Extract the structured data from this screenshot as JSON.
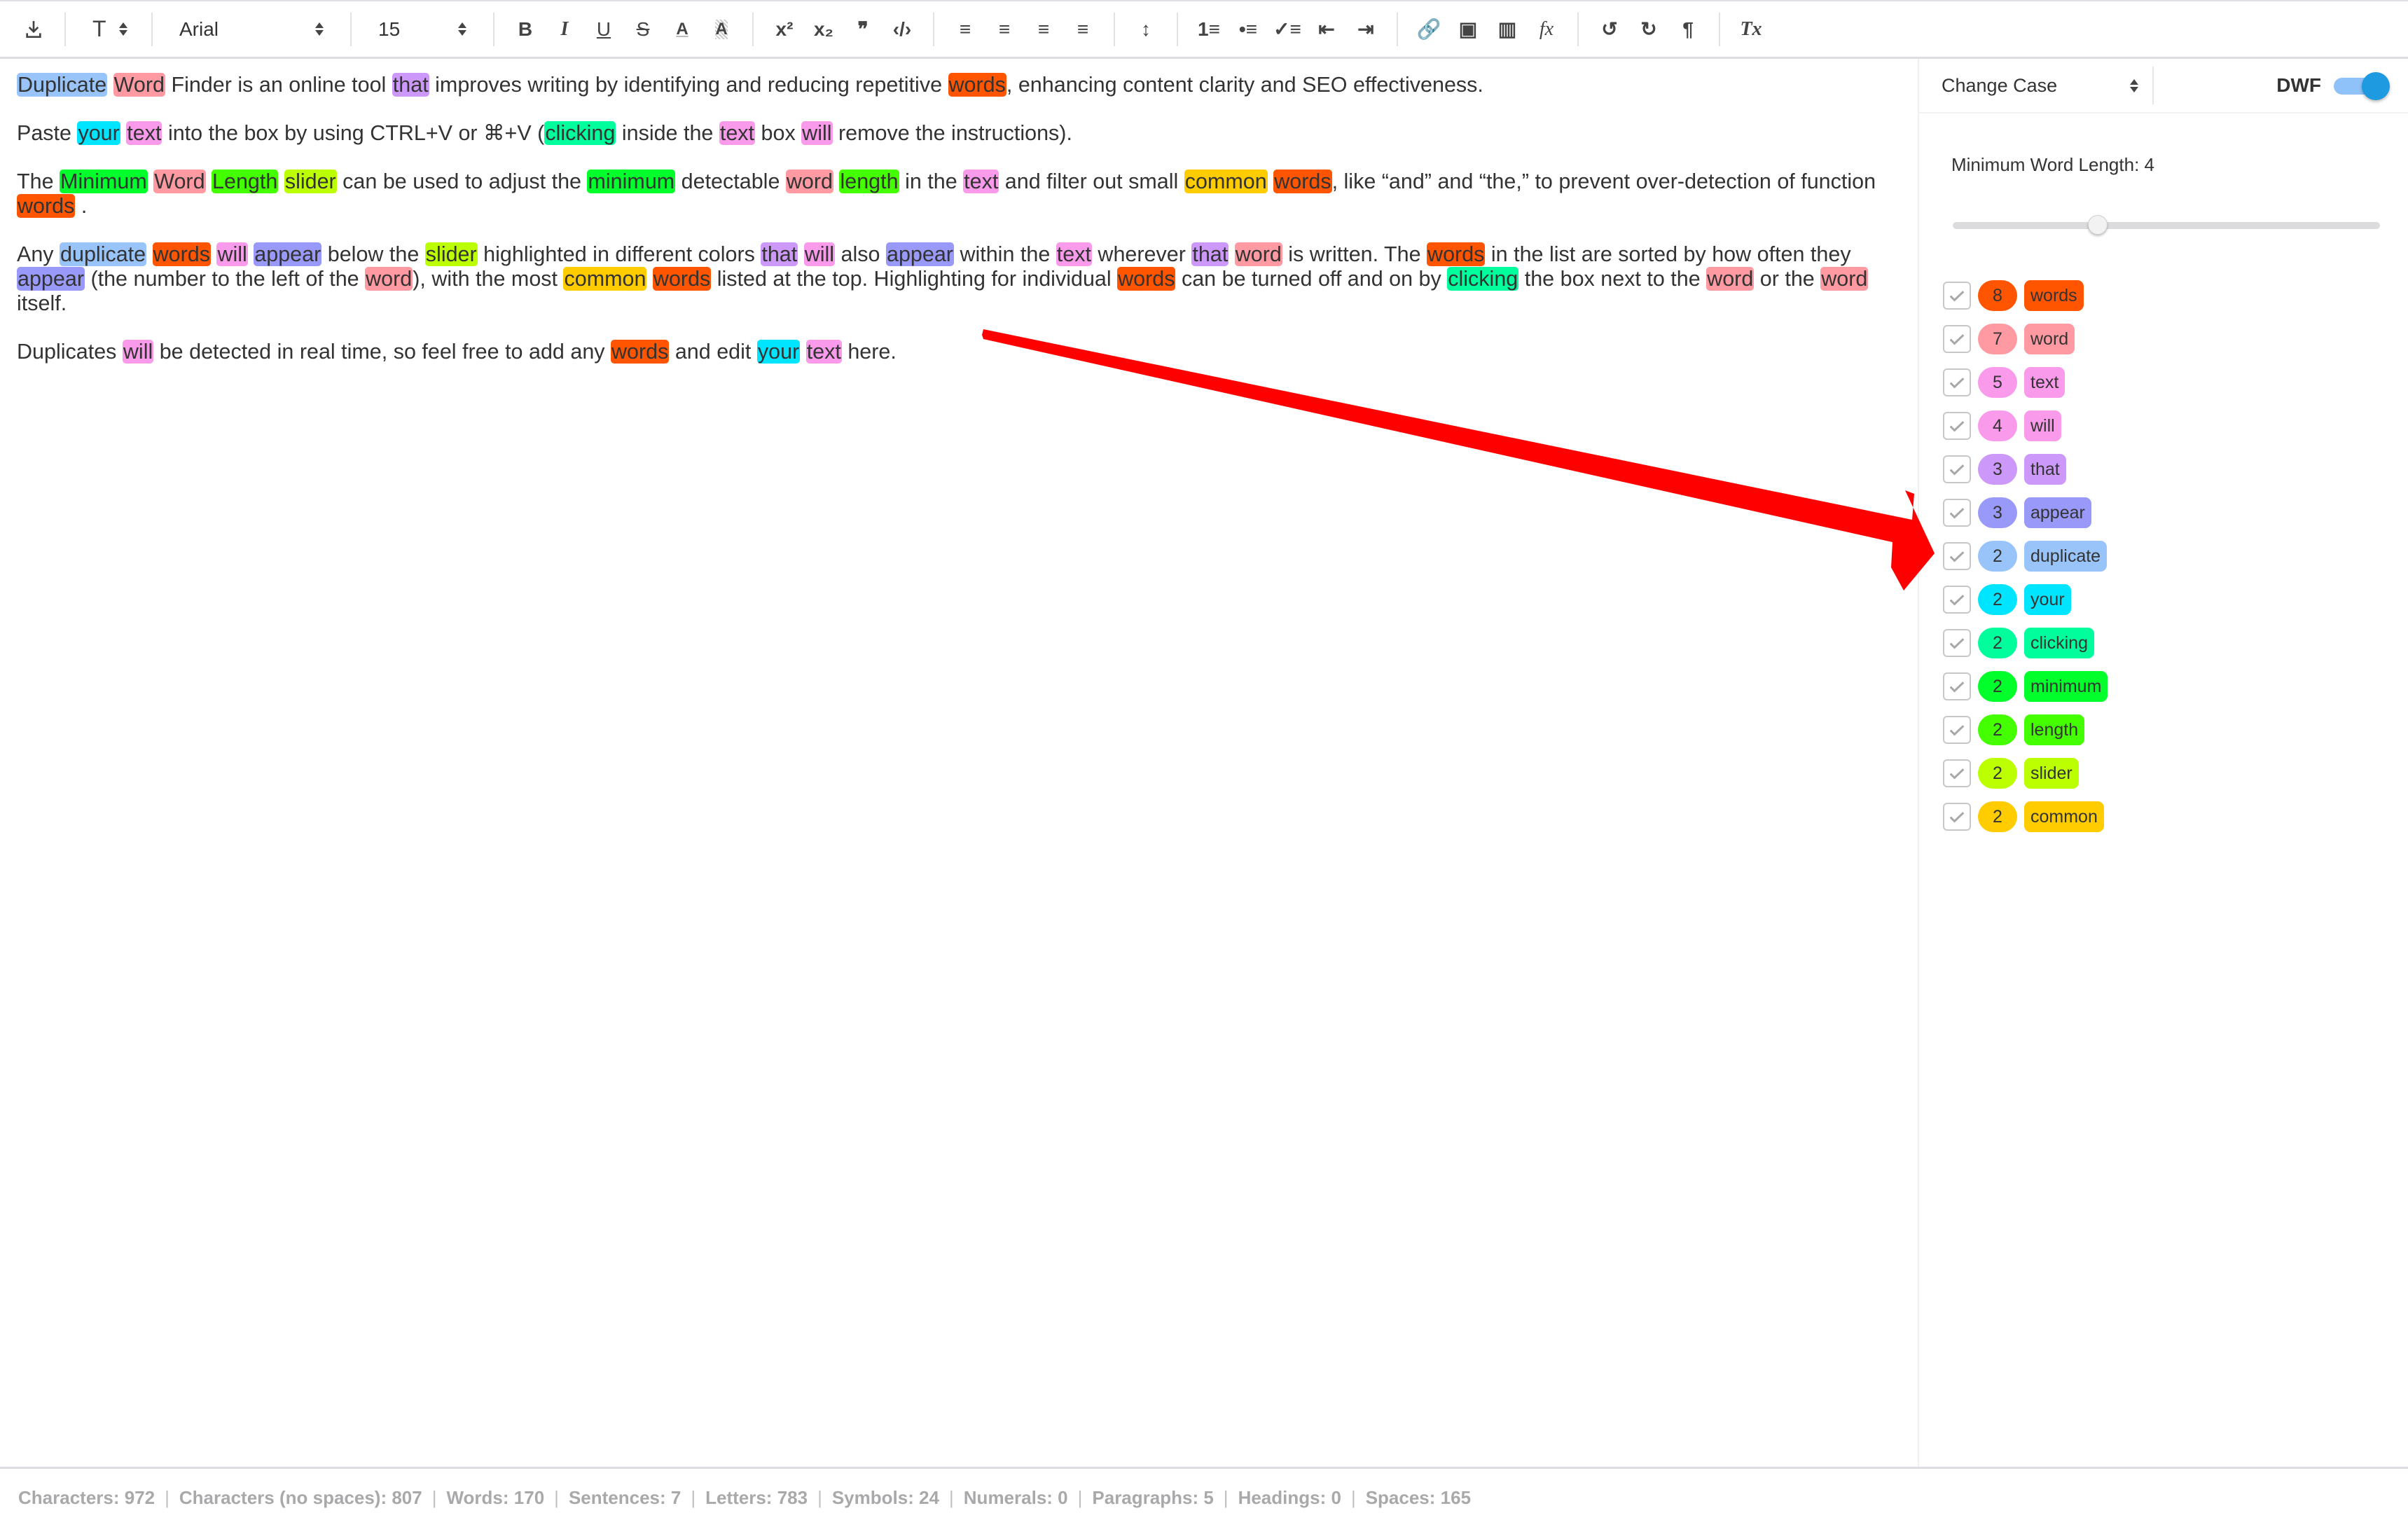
{
  "toolbar": {
    "download_icon": "download-icon",
    "text_style_label": "T",
    "font_family": "Arial",
    "font_size": "15",
    "buttons": [
      {
        "name": "bold",
        "glyph": "B"
      },
      {
        "name": "italic",
        "glyph": "I"
      },
      {
        "name": "underline",
        "glyph": "U"
      },
      {
        "name": "strikethrough",
        "glyph": "S"
      },
      {
        "name": "font-color",
        "glyph": "A"
      },
      {
        "name": "background-color",
        "glyph": "A"
      },
      {
        "name": "superscript",
        "glyph": "x²"
      },
      {
        "name": "subscript",
        "glyph": "x₂"
      },
      {
        "name": "blockquote",
        "glyph": "❞"
      },
      {
        "name": "code",
        "glyph": "‹/›"
      },
      {
        "name": "align-left",
        "glyph": "≡"
      },
      {
        "name": "align-center",
        "glyph": "≡"
      },
      {
        "name": "align-right",
        "glyph": "≡"
      },
      {
        "name": "align-justify",
        "glyph": "≡"
      },
      {
        "name": "line-height",
        "glyph": "↕"
      },
      {
        "name": "ordered-list",
        "glyph": "1≡"
      },
      {
        "name": "bullet-list",
        "glyph": "•≡"
      },
      {
        "name": "check-list",
        "glyph": "✓≡"
      },
      {
        "name": "outdent",
        "glyph": "⇤"
      },
      {
        "name": "indent",
        "glyph": "⇥"
      },
      {
        "name": "link",
        "glyph": "🔗"
      },
      {
        "name": "image",
        "glyph": "▣"
      },
      {
        "name": "video",
        "glyph": "▥"
      },
      {
        "name": "formula",
        "glyph": "fx"
      },
      {
        "name": "undo",
        "glyph": "↺"
      },
      {
        "name": "redo",
        "glyph": "↻"
      },
      {
        "name": "text-direction",
        "glyph": "¶"
      },
      {
        "name": "clear-formatting",
        "glyph": "Tx"
      }
    ]
  },
  "colors": {
    "words": "#ff5500",
    "word": "#ff9aa2",
    "text": "#fa9aeb",
    "will": "#fa9aeb",
    "that": "#cc99fa",
    "appear": "#9999fa",
    "duplicate": "#99c4fa",
    "your": "#00e5ff",
    "clicking": "#00ff9c",
    "minimum": "#00ff2b",
    "length": "#44ff00",
    "slider": "#bbff00",
    "common": "#ffcc00",
    "arrow": "#ff0000",
    "toggle_track": "#90c2fa",
    "toggle_knob": "#1e9be0"
  },
  "editor": {
    "paragraphs": [
      [
        {
          "t": "Duplicate",
          "hl": "duplicate"
        },
        {
          "t": " "
        },
        {
          "t": "Word",
          "hl": "word"
        },
        {
          "t": " Finder is an online tool "
        },
        {
          "t": "that",
          "hl": "that"
        },
        {
          "t": " improves writing by identifying and reducing repetitive "
        },
        {
          "t": "words",
          "hl": "words"
        },
        {
          "t": ", enhancing content clarity and SEO effectiveness."
        }
      ],
      [
        {
          "t": "Paste "
        },
        {
          "t": "your",
          "hl": "your"
        },
        {
          "t": " "
        },
        {
          "t": "text",
          "hl": "text"
        },
        {
          "t": " into the box by using CTRL+V or ⌘+V ("
        },
        {
          "t": "clicking",
          "hl": "clicking"
        },
        {
          "t": " inside the "
        },
        {
          "t": "text",
          "hl": "text"
        },
        {
          "t": " box "
        },
        {
          "t": "will",
          "hl": "will"
        },
        {
          "t": " remove the instructions)."
        }
      ],
      [
        {
          "t": "The "
        },
        {
          "t": "Minimum",
          "hl": "minimum"
        },
        {
          "t": " "
        },
        {
          "t": "Word",
          "hl": "word"
        },
        {
          "t": " "
        },
        {
          "t": "Length",
          "hl": "length"
        },
        {
          "t": " "
        },
        {
          "t": "slider",
          "hl": "slider"
        },
        {
          "t": " can be used to adjust the "
        },
        {
          "t": "minimum",
          "hl": "minimum"
        },
        {
          "t": " detectable "
        },
        {
          "t": "word",
          "hl": "word"
        },
        {
          "t": " "
        },
        {
          "t": "length",
          "hl": "length"
        },
        {
          "t": " in the "
        },
        {
          "t": "text",
          "hl": "text"
        },
        {
          "t": " and filter out small "
        },
        {
          "t": "common",
          "hl": "common"
        },
        {
          "t": " "
        },
        {
          "t": "words",
          "hl": "words"
        },
        {
          "t": ", like “and” and “the,” to prevent over-detection of function "
        },
        {
          "t": "words",
          "hl": "words"
        },
        {
          "t": " ."
        }
      ],
      [
        {
          "t": "Any "
        },
        {
          "t": "duplicate",
          "hl": "duplicate"
        },
        {
          "t": " "
        },
        {
          "t": "words",
          "hl": "words"
        },
        {
          "t": " "
        },
        {
          "t": "will",
          "hl": "will"
        },
        {
          "t": " "
        },
        {
          "t": "appear",
          "hl": "appear"
        },
        {
          "t": " below the "
        },
        {
          "t": "slider",
          "hl": "slider"
        },
        {
          "t": " highlighted in different colors "
        },
        {
          "t": "that",
          "hl": "that"
        },
        {
          "t": " "
        },
        {
          "t": "will",
          "hl": "will"
        },
        {
          "t": " also "
        },
        {
          "t": "appear",
          "hl": "appear"
        },
        {
          "t": " within the "
        },
        {
          "t": "text",
          "hl": "text"
        },
        {
          "t": " wherever "
        },
        {
          "t": "that",
          "hl": "that"
        },
        {
          "t": " "
        },
        {
          "t": "word",
          "hl": "word"
        },
        {
          "t": " is written. The "
        },
        {
          "t": "words",
          "hl": "words"
        },
        {
          "t": " in the list are sorted by how often they "
        },
        {
          "t": "appear",
          "hl": "appear"
        },
        {
          "t": " (the number to the left of the "
        },
        {
          "t": "word",
          "hl": "word"
        },
        {
          "t": "), with the most "
        },
        {
          "t": "common",
          "hl": "common"
        },
        {
          "t": " "
        },
        {
          "t": "words",
          "hl": "words"
        },
        {
          "t": " listed at the top. Highlighting for individual "
        },
        {
          "t": "words",
          "hl": "words"
        },
        {
          "t": " can be turned off and on by "
        },
        {
          "t": "clicking",
          "hl": "clicking"
        },
        {
          "t": " the box next to the "
        },
        {
          "t": "word",
          "hl": "word"
        },
        {
          "t": " or the "
        },
        {
          "t": "word",
          "hl": "word"
        },
        {
          "t": " itself."
        }
      ],
      [
        {
          "t": "Duplicates "
        },
        {
          "t": "will",
          "hl": "will"
        },
        {
          "t": " be detected in real time, so feel free to add any "
        },
        {
          "t": "words",
          "hl": "words"
        },
        {
          "t": " and edit "
        },
        {
          "t": "your",
          "hl": "your"
        },
        {
          "t": " "
        },
        {
          "t": "text",
          "hl": "text"
        },
        {
          "t": " here."
        }
      ]
    ]
  },
  "sidebar": {
    "change_case_label": "Change Case",
    "dwf_label": "DWF",
    "dwf_enabled": true,
    "min_word_length_label": "Minimum Word Length: 4",
    "min_word_length_value": 4,
    "slider_fraction": 0.34,
    "words": [
      {
        "count": "8",
        "word": "words",
        "checked": true
      },
      {
        "count": "7",
        "word": "word",
        "checked": true
      },
      {
        "count": "5",
        "word": "text",
        "checked": true
      },
      {
        "count": "4",
        "word": "will",
        "checked": true
      },
      {
        "count": "3",
        "word": "that",
        "checked": true
      },
      {
        "count": "3",
        "word": "appear",
        "checked": true
      },
      {
        "count": "2",
        "word": "duplicate",
        "checked": true
      },
      {
        "count": "2",
        "word": "your",
        "checked": true
      },
      {
        "count": "2",
        "word": "clicking",
        "checked": true
      },
      {
        "count": "2",
        "word": "minimum",
        "checked": true
      },
      {
        "count": "2",
        "word": "length",
        "checked": true
      },
      {
        "count": "2",
        "word": "slider",
        "checked": true
      },
      {
        "count": "2",
        "word": "common",
        "checked": true
      }
    ]
  },
  "footer": {
    "stats": [
      "Characters: 972",
      "Characters (no spaces): 807",
      "Words: 170",
      "Sentences: 7",
      "Letters: 783",
      "Symbols: 24",
      "Numerals: 0",
      "Paragraphs: 5",
      "Headings: 0",
      "Spaces: 165"
    ]
  },
  "annotation": {
    "type": "arrow",
    "points_to": "word-list"
  }
}
